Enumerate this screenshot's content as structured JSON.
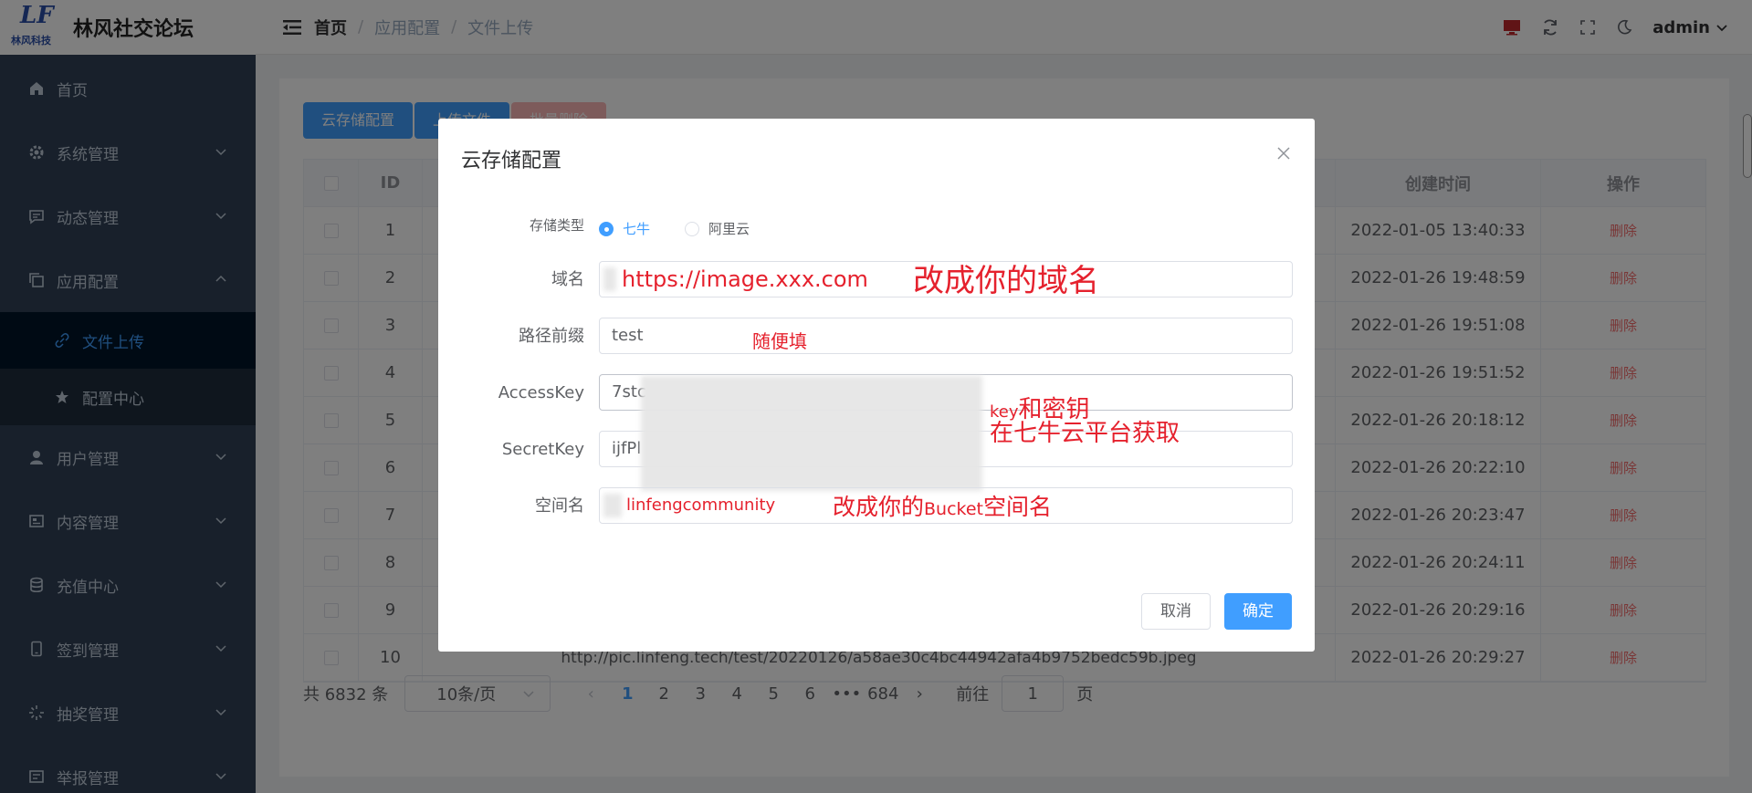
{
  "app": {
    "title": "林风社交论坛",
    "logo_text": "LF",
    "logo_sub": "林风科技"
  },
  "header": {
    "breadcrumb": [
      "首页",
      "应用配置",
      "文件上传"
    ],
    "user": "admin"
  },
  "sidebar": {
    "items": [
      {
        "label": "首页",
        "icon": "home-icon"
      },
      {
        "label": "系统管理",
        "icon": "gear-icon"
      },
      {
        "label": "动态管理",
        "icon": "chat-icon"
      },
      {
        "label": "应用配置",
        "icon": "copy-icon"
      },
      {
        "label": "文件上传",
        "icon": "link-icon",
        "sub": true,
        "active": true
      },
      {
        "label": "配置中心",
        "icon": "star-icon",
        "sub": true
      },
      {
        "label": "用户管理",
        "icon": "user-icon"
      },
      {
        "label": "内容管理",
        "icon": "content-icon"
      },
      {
        "label": "充值中心",
        "icon": "database-icon"
      },
      {
        "label": "签到管理",
        "icon": "phone-icon"
      },
      {
        "label": "抽奖管理",
        "icon": "loading-icon"
      },
      {
        "label": "举报管理",
        "icon": "report-icon"
      }
    ]
  },
  "toolbar": {
    "cloud_btn": "云存储配置",
    "upload_btn": "上传文件",
    "batch_delete_btn": "批量删除"
  },
  "table": {
    "headers": {
      "id": "ID",
      "time": "创建时间",
      "op": "操作"
    },
    "rows": [
      {
        "id": "1",
        "url": "",
        "time": "2022-01-05 13:40:33",
        "op": "删除"
      },
      {
        "id": "2",
        "url": "",
        "time": "2022-01-26 19:48:59",
        "op": "删除"
      },
      {
        "id": "3",
        "url": "",
        "time": "2022-01-26 19:51:08",
        "op": "删除"
      },
      {
        "id": "4",
        "url": "",
        "time": "2022-01-26 19:51:52",
        "op": "删除"
      },
      {
        "id": "5",
        "url": "",
        "time": "2022-01-26 20:18:12",
        "op": "删除"
      },
      {
        "id": "6",
        "url": "",
        "time": "2022-01-26 20:22:10",
        "op": "删除"
      },
      {
        "id": "7",
        "url": "",
        "time": "2022-01-26 20:23:47",
        "op": "删除"
      },
      {
        "id": "8",
        "url": "",
        "time": "2022-01-26 20:24:11",
        "op": "删除"
      },
      {
        "id": "9",
        "url": "",
        "time": "2022-01-26 20:29:16",
        "op": "删除"
      },
      {
        "id": "10",
        "url": "http://pic.linfeng.tech/test/20220126/a58ae30c4bc44942afa4b9752bedc59b.jpeg",
        "time": "2022-01-26 20:29:27",
        "op": "删除"
      }
    ]
  },
  "pagination": {
    "total": "共 6832 条",
    "page_size": "10条/页",
    "pages": [
      "1",
      "2",
      "3",
      "4",
      "5",
      "6",
      "•••",
      "684"
    ],
    "current": "1",
    "goto_prefix": "前往",
    "goto_value": "1",
    "goto_suffix": "页"
  },
  "dialog": {
    "title": "云存储配置",
    "storage_label": "存储类型",
    "storage_options": [
      "七牛",
      "阿里云"
    ],
    "storage_selected": "七牛",
    "domain_label": "域名",
    "domain_value": "https://image.xxx.com",
    "prefix_label": "路径前缀",
    "prefix_value": "test",
    "access_label": "AccessKey",
    "access_value": "7stc",
    "secret_label": "SecretKey",
    "secret_value": "ijfPl",
    "bucket_label": "空间名",
    "bucket_value": "linfengcommunity",
    "cancel": "取消",
    "confirm": "确定"
  },
  "annotations": {
    "domain": "改成你的域名",
    "prefix": "随便填",
    "key_small": "key",
    "key_rest": "和密钥",
    "platform": "在七牛云平台获取",
    "bucket_pre": "改成你的",
    "bucket_mid": "Bucket",
    "bucket_post": "空间名"
  },
  "colors": {
    "primary": "#409eff",
    "danger": "#f56c6c",
    "annotation": "#e5212d",
    "sidebar": "#304156"
  }
}
